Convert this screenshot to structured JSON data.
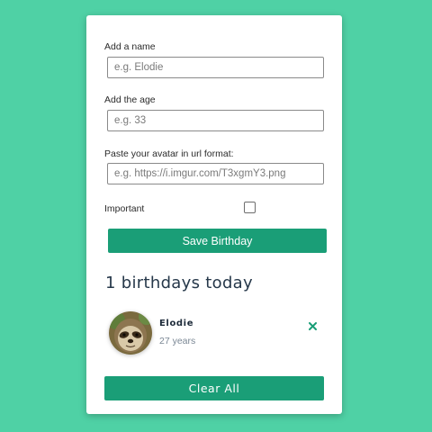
{
  "form": {
    "name_label": "Add a name",
    "name_placeholder": "e.g. Elodie",
    "age_label": "Add the age",
    "age_placeholder": "e.g. 33",
    "avatar_label": "Paste your avatar in url format:",
    "avatar_placeholder": "e.g. https://i.imgur.com/T3xgmY3.png",
    "important_label": "Important",
    "important_checked": false,
    "save_label": "Save Birthday"
  },
  "list": {
    "heading": "1 birthdays today",
    "items": [
      {
        "name": "Elodie",
        "age": "27 years",
        "avatar_icon": "sloth-avatar",
        "remove_icon": "close-icon"
      }
    ]
  },
  "clear_label": "Clear All",
  "colors": {
    "background": "#4fd1a5",
    "accent": "#1a9e77",
    "card": "#ffffff",
    "heading": "#26384a"
  }
}
